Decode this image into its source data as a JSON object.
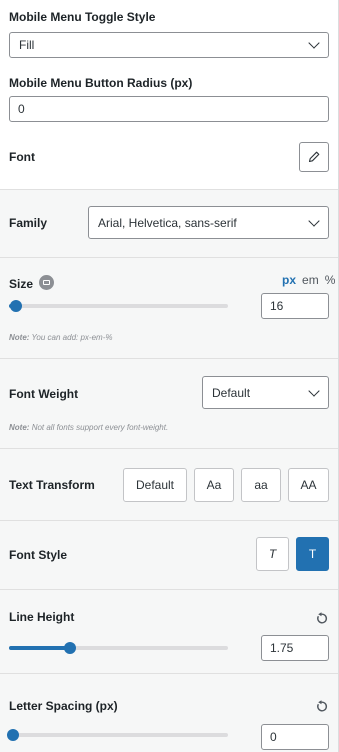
{
  "toggle_style": {
    "label": "Mobile Menu Toggle Style",
    "value": "Fill"
  },
  "button_radius": {
    "label": "Mobile Menu Button Radius (px)",
    "value": "0"
  },
  "font": {
    "label": "Font"
  },
  "family": {
    "label": "Family",
    "value": "Arial, Helvetica, sans-serif"
  },
  "size": {
    "label": "Size",
    "units": [
      "px",
      "em",
      "%"
    ],
    "active_unit": "px",
    "value": "16",
    "slider_fraction": 0.03,
    "note_prefix": "Note:",
    "note_text": "You can add: px-em-%"
  },
  "font_weight": {
    "label": "Font Weight",
    "value": "Default",
    "note_prefix": "Note:",
    "note_text": "Not all fonts support every font-weight."
  },
  "text_transform": {
    "label": "Text Transform",
    "options": [
      "Default",
      "Aa",
      "aa",
      "AA"
    ]
  },
  "font_style": {
    "label": "Font Style",
    "options": [
      "T",
      "T"
    ],
    "active_index": 1
  },
  "line_height": {
    "label": "Line Height",
    "value": "1.75",
    "slider_fraction": 0.28
  },
  "letter_spacing": {
    "label": "Letter Spacing (px)",
    "value": "0",
    "slider_fraction": 0.0
  }
}
